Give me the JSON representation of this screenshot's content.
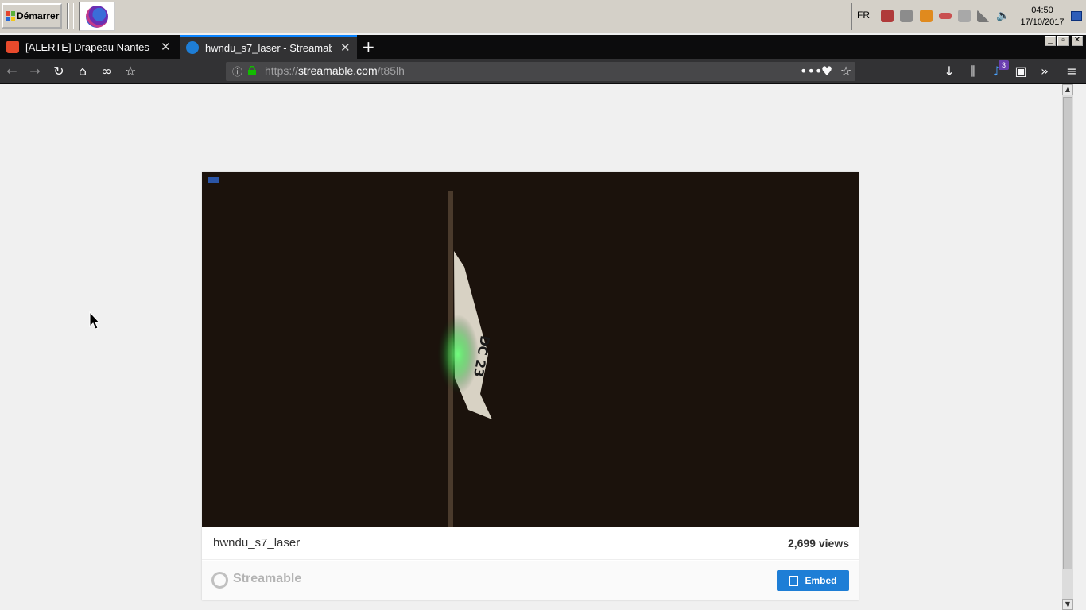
{
  "taskbar": {
    "start_label": "Démarrer",
    "language": "FR",
    "clock_time": "04:50",
    "clock_date": "17/10/2017"
  },
  "browser": {
    "tabs": [
      {
        "title": "[ALERTE] Drapeau Nantes : r",
        "favicon_color": "#e84a2c",
        "active": false
      },
      {
        "title": "hwndu_s7_laser - Streamab",
        "favicon_color": "#1e7ed6",
        "active": true
      }
    ],
    "url_prefix": "https://",
    "url_host": "streamable.com",
    "url_path": "/t85lh",
    "notification_count": "3"
  },
  "page": {
    "video_title": "hwndu_s7_laser",
    "views": "2,699 views",
    "brand": "Streamable",
    "embed_label": "Embed"
  },
  "colors": {
    "accent": "#1e7ed6",
    "tab_active_border": "#0a84ff",
    "video_bg": "#1b120c"
  }
}
